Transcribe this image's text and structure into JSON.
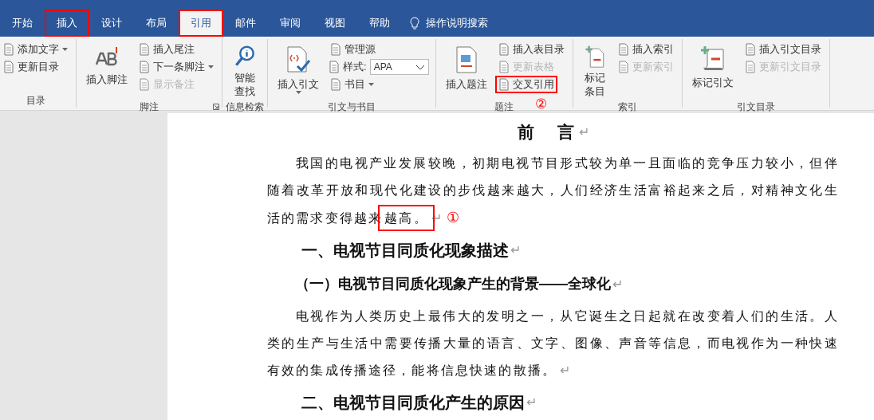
{
  "tabs": [
    {
      "label": "开始",
      "selected": false,
      "annotated": false
    },
    {
      "label": "插入",
      "selected": false,
      "annotated": true
    },
    {
      "label": "设计",
      "selected": false,
      "annotated": false
    },
    {
      "label": "布局",
      "selected": false,
      "annotated": false
    },
    {
      "label": "引用",
      "selected": true,
      "annotated": true
    },
    {
      "label": "邮件",
      "selected": false,
      "annotated": false
    },
    {
      "label": "审阅",
      "selected": false,
      "annotated": false
    },
    {
      "label": "视图",
      "selected": false,
      "annotated": false
    },
    {
      "label": "帮助",
      "selected": false,
      "annotated": false
    }
  ],
  "tell_me": {
    "label": "操作说明搜索"
  },
  "ribbon_groups": [
    {
      "label": "目录",
      "launcher": false,
      "items": [
        {
          "kind": "small",
          "label": "添加文字",
          "dropdown": true,
          "disabled": false,
          "annotated": false
        },
        {
          "kind": "small",
          "label": "更新目录",
          "dropdown": false,
          "disabled": false,
          "annotated": false
        }
      ]
    },
    {
      "label": "脚注",
      "launcher": true,
      "items": [
        {
          "kind": "large",
          "lines": [
            "插入脚注"
          ],
          "dropdown": false,
          "disabled": false,
          "annotated": false
        },
        {
          "kind": "small",
          "label": "插入尾注",
          "dropdown": false,
          "disabled": false,
          "annotated": false
        },
        {
          "kind": "small",
          "label": "下一条脚注",
          "dropdown": true,
          "disabled": false,
          "annotated": false
        },
        {
          "kind": "small",
          "label": "显示备注",
          "dropdown": false,
          "disabled": true,
          "annotated": false
        }
      ]
    },
    {
      "label": "信息检索",
      "launcher": false,
      "items": [
        {
          "kind": "large",
          "lines": [
            "智能",
            "查找"
          ],
          "dropdown": false,
          "disabled": false,
          "annotated": false
        }
      ]
    },
    {
      "label": "引文与书目",
      "launcher": false,
      "items": [
        {
          "kind": "large",
          "lines": [
            "插入引文"
          ],
          "dropdown": true,
          "disabled": false,
          "annotated": false
        },
        {
          "kind": "small",
          "label": "管理源",
          "dropdown": false,
          "disabled": false,
          "annotated": false
        },
        {
          "kind": "style",
          "label": "样式:",
          "value": "APA",
          "dropdown": true,
          "disabled": false,
          "annotated": false
        },
        {
          "kind": "small",
          "label": "书目",
          "dropdown": true,
          "disabled": false,
          "annotated": false
        }
      ]
    },
    {
      "label": "题注",
      "launcher": false,
      "items": [
        {
          "kind": "large",
          "lines": [
            "插入题注"
          ],
          "dropdown": false,
          "disabled": false,
          "annotated": false
        },
        {
          "kind": "small",
          "label": "插入表目录",
          "dropdown": false,
          "disabled": false,
          "annotated": false
        },
        {
          "kind": "small",
          "label": "更新表格",
          "dropdown": false,
          "disabled": true,
          "annotated": false
        },
        {
          "kind": "small",
          "label": "交叉引用",
          "dropdown": false,
          "disabled": false,
          "annotated": true,
          "marker": "②"
        }
      ]
    },
    {
      "label": "索引",
      "launcher": false,
      "items": [
        {
          "kind": "large",
          "lines": [
            "标记",
            "条目"
          ],
          "dropdown": false,
          "disabled": false,
          "annotated": false
        },
        {
          "kind": "small",
          "label": "插入索引",
          "dropdown": false,
          "disabled": false,
          "annotated": false
        },
        {
          "kind": "small",
          "label": "更新索引",
          "dropdown": false,
          "disabled": true,
          "annotated": false
        }
      ]
    },
    {
      "label": "引文目录",
      "launcher": false,
      "items": [
        {
          "kind": "large",
          "lines": [
            "标记引文"
          ],
          "dropdown": false,
          "disabled": false,
          "annotated": false
        },
        {
          "kind": "small",
          "label": "插入引文目录",
          "dropdown": false,
          "disabled": false,
          "annotated": false
        },
        {
          "kind": "small",
          "label": "更新引文目录",
          "dropdown": false,
          "disabled": true,
          "annotated": false
        }
      ]
    }
  ],
  "document": [
    {
      "kind": "title",
      "text": "前　言",
      "end_mark": "↵"
    },
    {
      "kind": "para",
      "text": "我国的电视产业发展较晚，初期电视节目形式较为单一且面临的竞争压力较小，但伴随着改革开放和现代化建设的步伐越来越大，人们经济生活富裕起来之后，对精神文化生活的需求变得越来",
      "annotated_text": "越高。",
      "marker": "①",
      "end_mark": "↵"
    },
    {
      "kind": "h1",
      "text": "一、电视节目同质化现象描述",
      "end_mark": "↵"
    },
    {
      "kind": "h2",
      "text": "（一）电视节目同质化现象产生的背景——全球化",
      "end_mark": "↵"
    },
    {
      "kind": "para",
      "text": "电视作为人类历史上最伟大的发明之一，从它诞生之日起就在改变着人们的生活。人类的生产与生活中需要传播大量的语言、文字、图像、声音等信息，而电视作为一种快速有效的集成传播途径，能将信息快速的散播。",
      "end_mark": "↵"
    },
    {
      "kind": "h1",
      "text": "二、电视节目同质化产生的原因",
      "end_mark": "↵"
    }
  ]
}
